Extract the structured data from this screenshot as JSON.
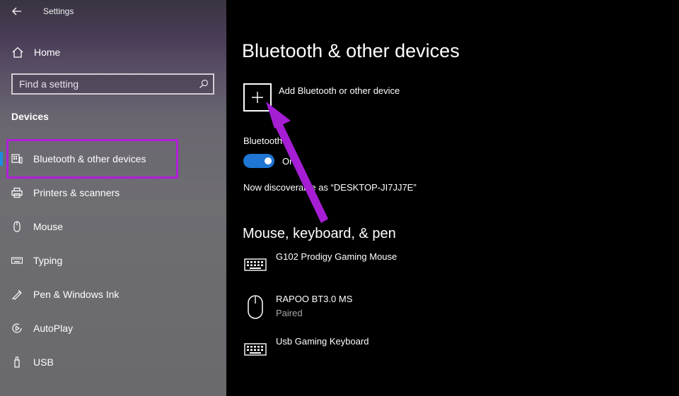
{
  "window": {
    "title": "Settings"
  },
  "sidebar": {
    "home_label": "Home",
    "search": {
      "placeholder": "Find a setting"
    },
    "section": "Devices",
    "items": [
      {
        "label": "Bluetooth & other devices",
        "icon": "bluetooth-devices-icon",
        "selected": true
      },
      {
        "label": "Printers & scanners",
        "icon": "printer-icon"
      },
      {
        "label": "Mouse",
        "icon": "mouse-icon"
      },
      {
        "label": "Typing",
        "icon": "keyboard-icon"
      },
      {
        "label": "Pen & Windows Ink",
        "icon": "pen-icon"
      },
      {
        "label": "AutoPlay",
        "icon": "autoplay-icon"
      },
      {
        "label": "USB",
        "icon": "usb-icon"
      }
    ]
  },
  "main": {
    "title": "Bluetooth & other devices",
    "add_device_label": "Add Bluetooth or other device",
    "bluetooth_label": "Bluetooth",
    "toggle_state": "On",
    "discoverable": "Now discoverable as “DESKTOP-JI7JJ7E”",
    "section_title": "Mouse, keyboard, & pen",
    "devices": [
      {
        "name": "G102 Prodigy Gaming Mouse",
        "status": "",
        "icon": "keyboard-icon"
      },
      {
        "name": "RAPOO BT3.0 MS",
        "status": "Paired",
        "icon": "mouse-icon"
      },
      {
        "name": "Usb Gaming Keyboard",
        "status": "",
        "icon": "keyboard-icon"
      }
    ]
  },
  "colors": {
    "accent": "#1f76d3",
    "selection_bar": "#1f8de0",
    "annotation": "#b11fd8"
  }
}
